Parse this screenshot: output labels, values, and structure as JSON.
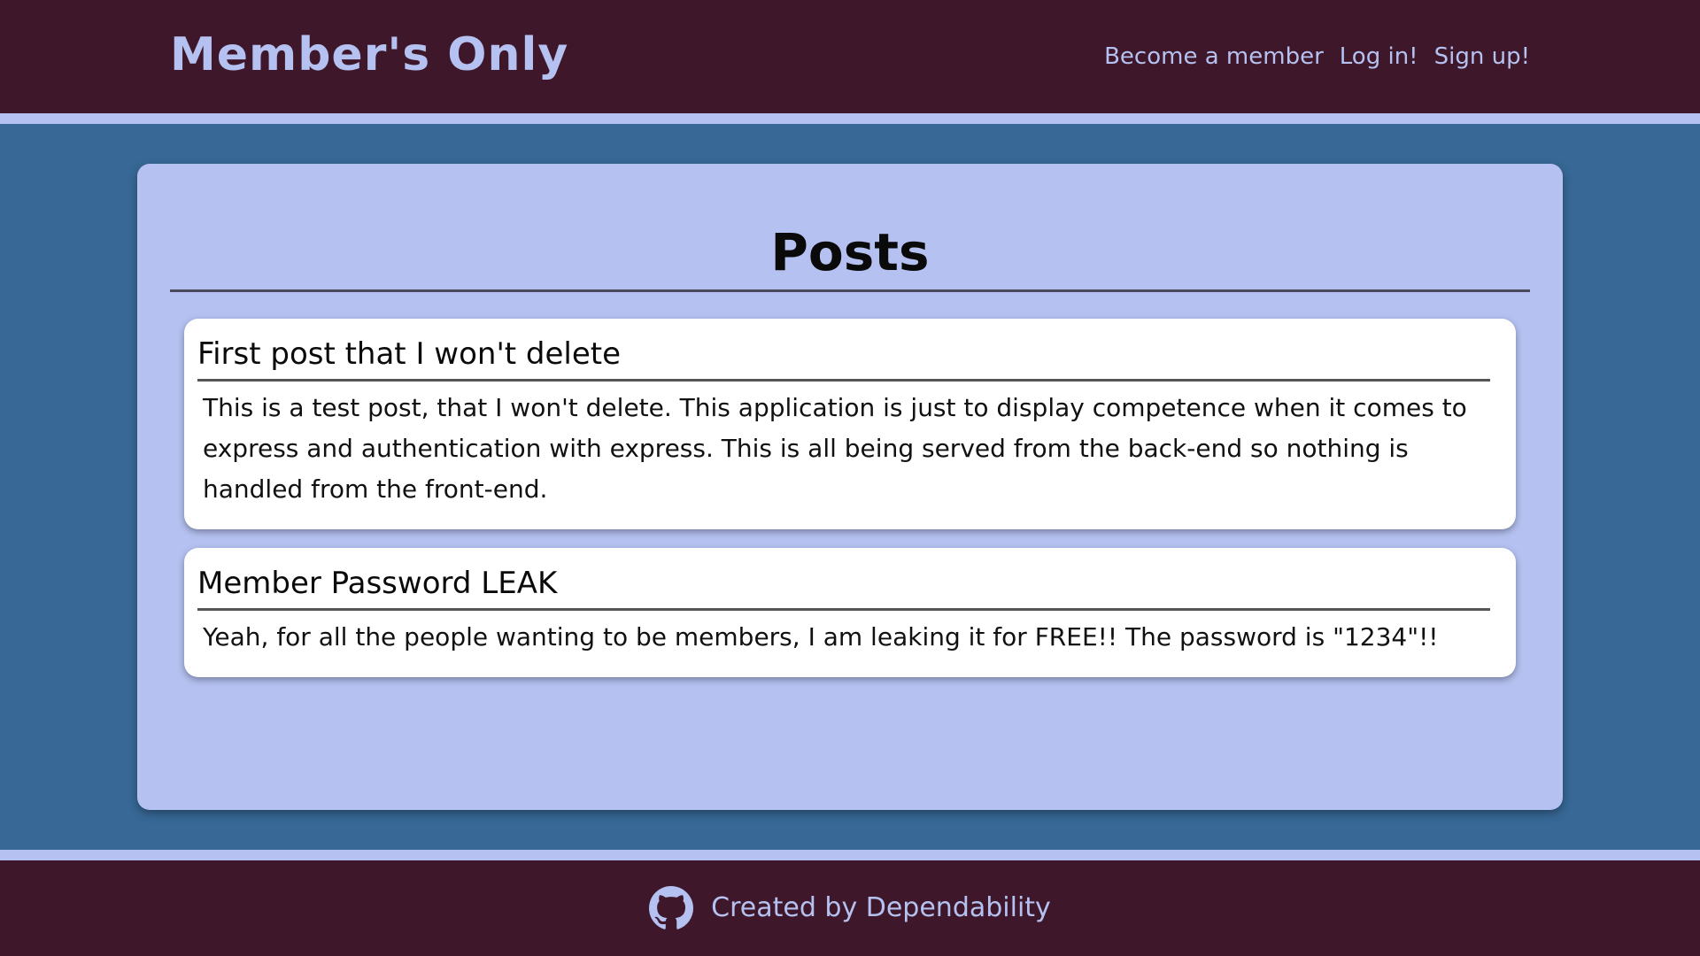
{
  "header": {
    "logo": "Member's Only",
    "nav": {
      "become_member": "Become a member",
      "log_in": "Log in!",
      "sign_up": "Sign up!"
    }
  },
  "main": {
    "title": "Posts",
    "posts": [
      {
        "title": "First post that I won't delete",
        "body": "This is a test post, that I won't delete. This application is just to display competence when it comes to express and authentication with express. This is all being served from the back-end so nothing is handled from the front-end."
      },
      {
        "title": "Member Password LEAK",
        "body": "Yeah, for all the people wanting to be members, I am leaking it for FREE!! The password is \"1234\"!!"
      }
    ]
  },
  "footer": {
    "icon": "github-icon",
    "text": "Created by Dependability"
  },
  "colors": {
    "header_bg": "#3e182a",
    "accent": "#b5c1f1",
    "page_bg": "#376896",
    "card_bg": "#ffffff"
  }
}
